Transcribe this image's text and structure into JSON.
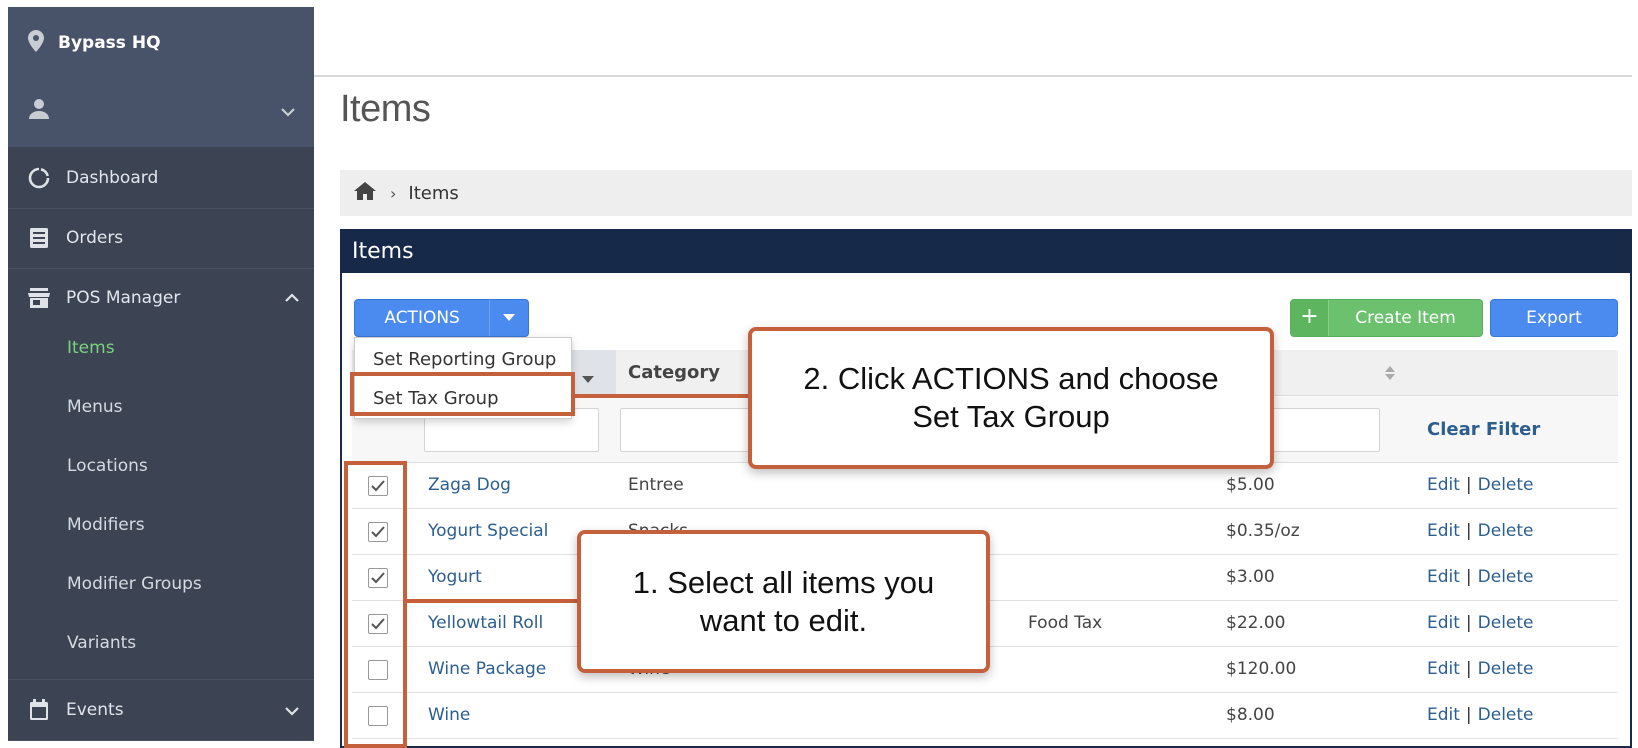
{
  "sidebar": {
    "location": "Bypass HQ",
    "nav": {
      "dashboard": "Dashboard",
      "orders": "Orders",
      "pos_manager": "POS Manager",
      "events": "Events"
    },
    "sub_items": [
      "Items",
      "Menus",
      "Locations",
      "Modifiers",
      "Modifier Groups",
      "Variants"
    ],
    "active_sub": "Items"
  },
  "page": {
    "title": "Items",
    "breadcrumb": "Items"
  },
  "panel": {
    "title": "Items",
    "actions_label": "ACTIONS",
    "create_label": "Create Item",
    "create_icon": "+",
    "export_label": "Export"
  },
  "dropdown": {
    "items": [
      "Set Reporting Group",
      "Set Tax Group"
    ]
  },
  "table": {
    "category_header": "Category",
    "clear_filter": "Clear Filter",
    "rows": [
      {
        "checked": true,
        "name": "Zaga Dog",
        "category": "Entree",
        "tax": "",
        "price": "$5.00"
      },
      {
        "checked": true,
        "name": "Yogurt Special",
        "category": "Snacks",
        "tax": "",
        "price": "$0.35/oz"
      },
      {
        "checked": true,
        "name": "Yogurt",
        "category": "",
        "tax": "",
        "price": "$3.00"
      },
      {
        "checked": true,
        "name": "Yellowtail Roll",
        "category": "",
        "tax": "Food Tax",
        "price": "$22.00"
      },
      {
        "checked": false,
        "name": "Wine Package",
        "category": "Wine",
        "tax": "",
        "price": "$120.00"
      },
      {
        "checked": false,
        "name": "Wine",
        "category": "",
        "tax": "",
        "price": "$8.00"
      }
    ],
    "edit_label": "Edit",
    "delete_label": "Delete",
    "separator": "|"
  },
  "annotations": {
    "step2_line1": "2. Click ACTIONS and choose",
    "step2_line2": "Set Tax Group",
    "step1_line1": "1. Select all items you",
    "step1_line2": "want to edit.",
    "accent_color": "#c5603c"
  }
}
